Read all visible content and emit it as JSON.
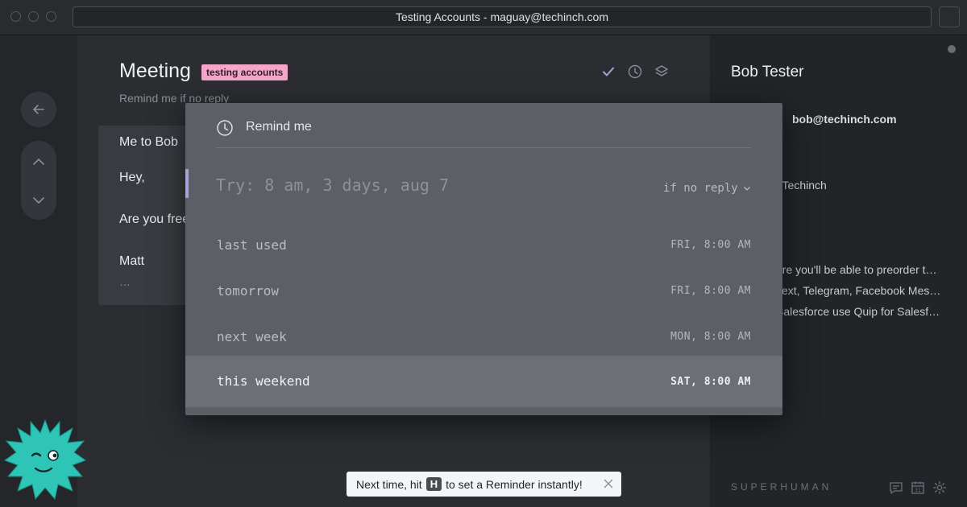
{
  "window": {
    "title": "Testing Accounts - maguay@techinch.com"
  },
  "email": {
    "subject": "Meeting",
    "label": "testing accounts",
    "remind_status": "Remind me if no reply",
    "thread": {
      "sender_line": "Me to Bob",
      "greeting": "Hey,",
      "body_fragment": "Are you free",
      "signature": "Matt",
      "more": "…"
    }
  },
  "reminder_modal": {
    "title": "Remind me",
    "input_placeholder": "Try: 8 am, 3 days, aug 7",
    "condition": "if no reply",
    "options": [
      {
        "label": "last used",
        "time": "FRI, 8:00 AM"
      },
      {
        "label": "tomorrow",
        "time": "FRI, 8:00 AM"
      },
      {
        "label": "next week",
        "time": "MON, 8:00 AM"
      },
      {
        "label": "this weekend",
        "time": "SAT, 8:00 AM"
      }
    ],
    "selected_index": 3
  },
  "contact": {
    "name": "Bob Tester",
    "email": "bob@techinch.com",
    "company": "t Techinch",
    "recent": [
      "ere you'll be able to preorder t…",
      "Text, Telegram, Facebook Mes…",
      "Salesforce use Quip for Salesf…"
    ]
  },
  "toast": {
    "prefix": "Next time, hit",
    "key": "H",
    "suffix": "to set a Reminder instantly!"
  },
  "footer": {
    "brand": "SUPERHUMAN"
  },
  "colors": {
    "label_bg": "#f3a6c8",
    "accent_cursor": "#a9a2d6",
    "mascot": "#2ec4b6"
  },
  "icons": [
    "back-arrow-icon",
    "chevron-up-icon",
    "chevron-down-icon",
    "checkmark-icon",
    "clock-icon",
    "layers-icon",
    "close-icon",
    "chat-icon",
    "calendar-icon",
    "gear-icon"
  ]
}
